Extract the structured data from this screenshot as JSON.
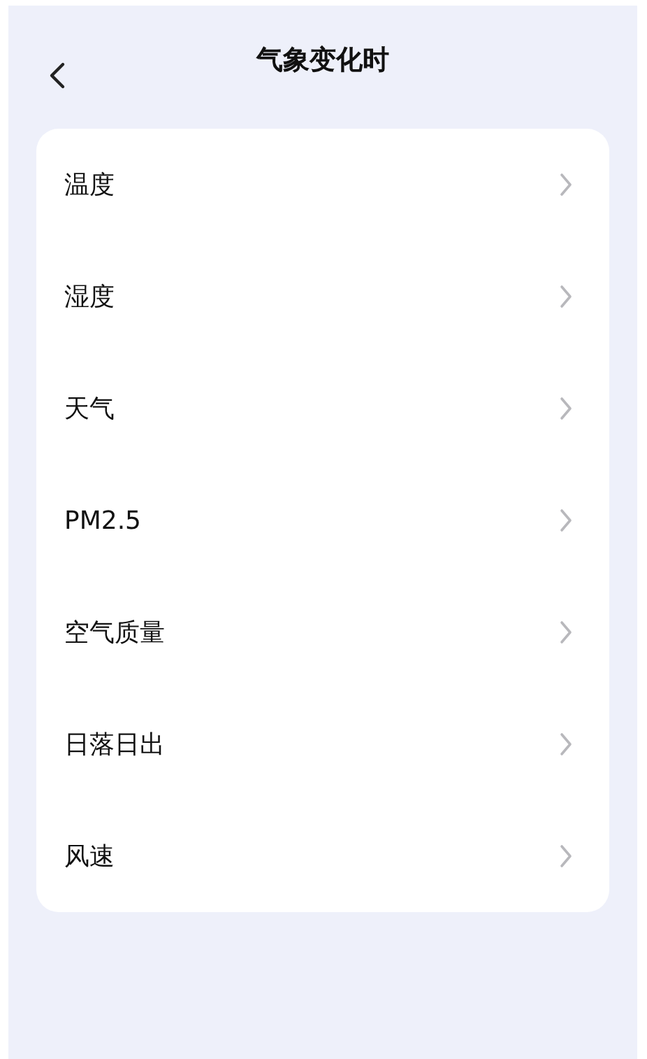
{
  "header": {
    "title": "气象变化时"
  },
  "items": [
    {
      "label": "温度"
    },
    {
      "label": "湿度"
    },
    {
      "label": "天气"
    },
    {
      "label": "PM2.5"
    },
    {
      "label": "空气质量"
    },
    {
      "label": "日落日出"
    },
    {
      "label": "风速"
    }
  ]
}
